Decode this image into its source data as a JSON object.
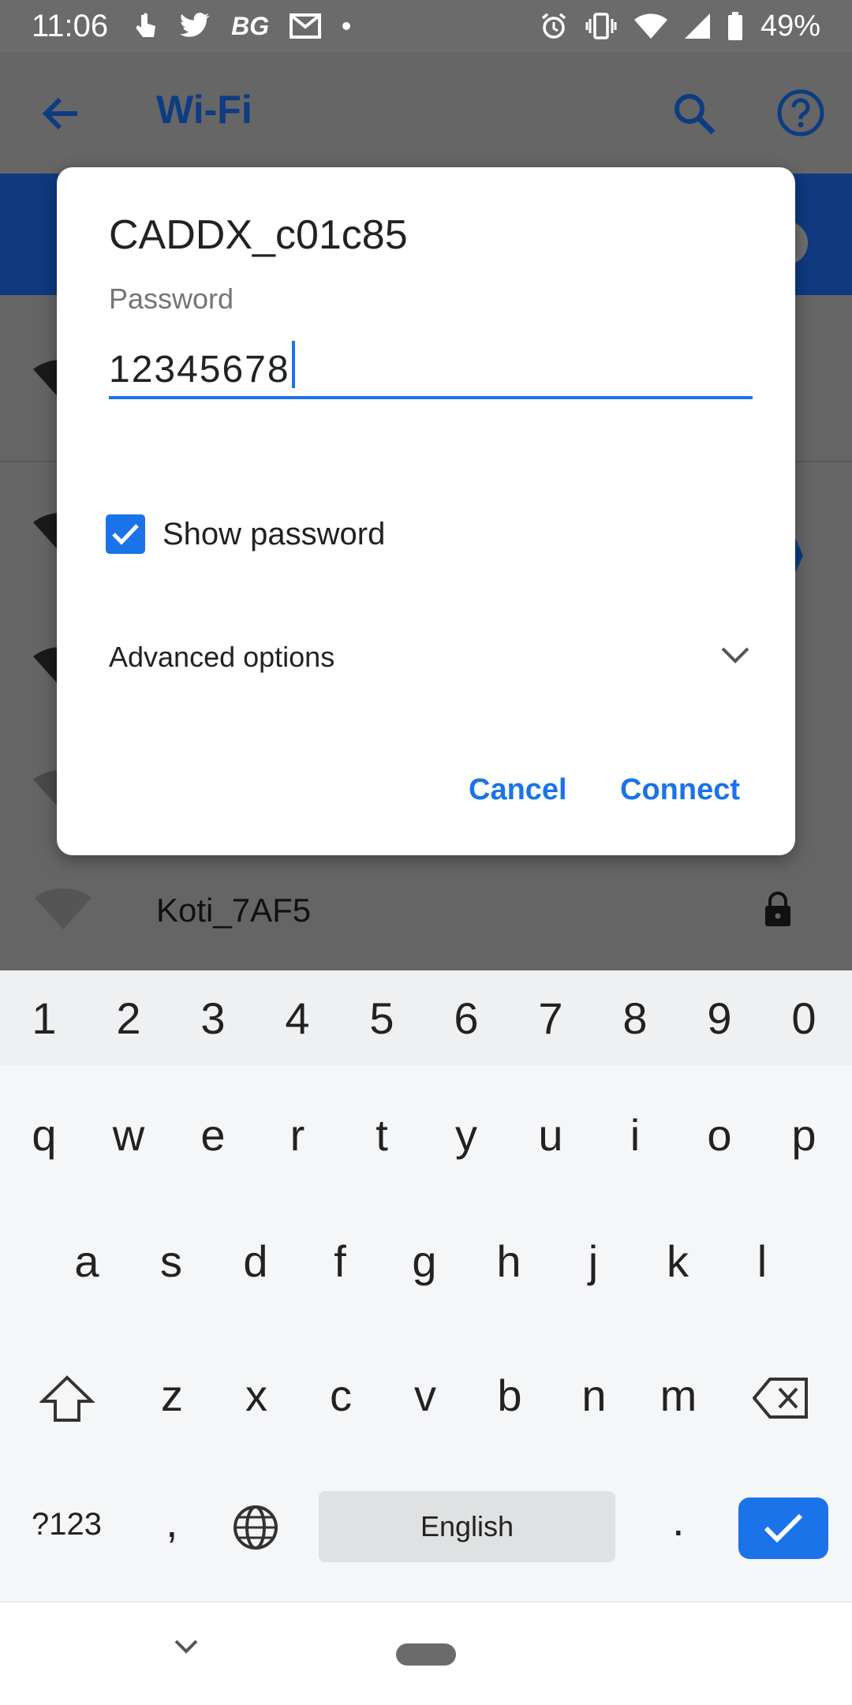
{
  "status": {
    "time": "11:06",
    "carrier_badge": "BG",
    "battery": "49%"
  },
  "appbar": {
    "title": "Wi-Fi"
  },
  "background_list": {
    "network_name": "Koti_7AF5"
  },
  "dialog": {
    "network": "CADDX_c01c85",
    "password_label": "Password",
    "password_value": "12345678",
    "show_password_label": "Show password",
    "show_password_checked": true,
    "advanced_options_label": "Advanced options",
    "cancel_label": "Cancel",
    "connect_label": "Connect"
  },
  "keyboard": {
    "number_row": [
      "1",
      "2",
      "3",
      "4",
      "5",
      "6",
      "7",
      "8",
      "9",
      "0"
    ],
    "row1": [
      "q",
      "w",
      "e",
      "r",
      "t",
      "y",
      "u",
      "i",
      "o",
      "p"
    ],
    "row2": [
      "a",
      "s",
      "d",
      "f",
      "g",
      "h",
      "j",
      "k",
      "l"
    ],
    "row3": [
      "z",
      "x",
      "c",
      "v",
      "b",
      "n",
      "m"
    ],
    "symbols_key": "?123",
    "comma_key": ",",
    "space_label": "English",
    "period_key": "."
  },
  "colors": {
    "accent": "#1a73e8",
    "dark_title": "#0d3c82"
  }
}
